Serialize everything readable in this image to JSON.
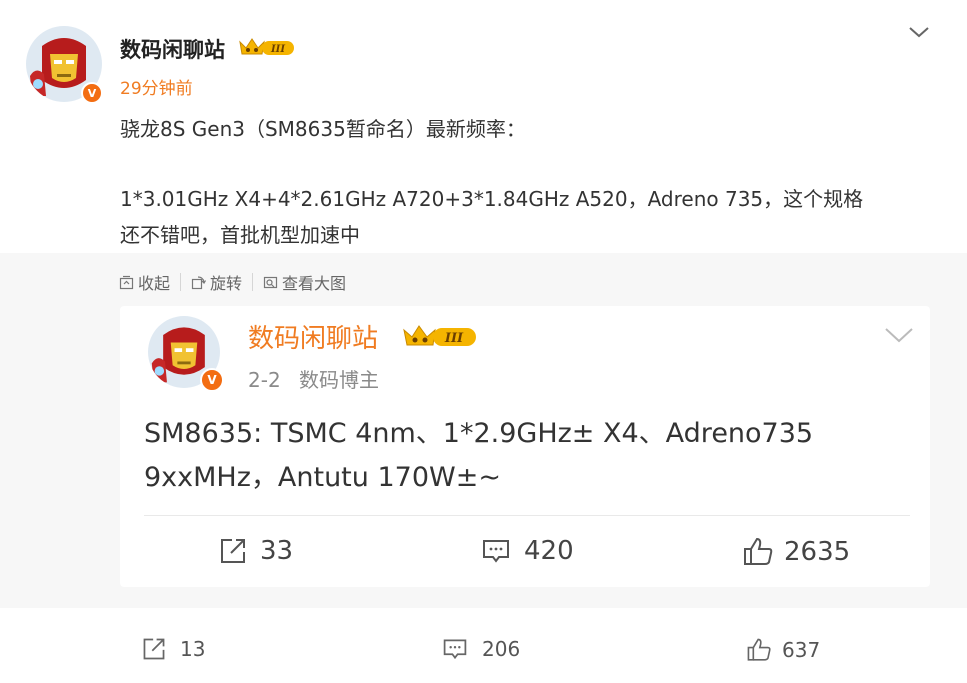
{
  "post": {
    "author": "数码闲聊站",
    "time": "29分钟前",
    "content_lines": [
      "骁龙8S Gen3（SM8635暂命名）最新频率：",
      "1*3.01GHz X4+4*2.61GHz A720+3*1.84GHz A520，Adreno 735，这个规格",
      "还不错吧，首批机型加速中"
    ],
    "level_badge": "III",
    "verified_badge": "V",
    "mini_actions": {
      "collapse": "收起",
      "rotate": "旋转",
      "view_large": "查看大图"
    },
    "stats": {
      "reposts": "13",
      "comments": "206",
      "likes": "637"
    }
  },
  "retweet": {
    "author": "数码闲聊站",
    "date": "2-2",
    "role": "数码博主",
    "content_lines": [
      "SM8635: TSMC 4nm、1*2.9GHz± X4、Adreno735",
      "9xxMHz，Antutu 170W±~"
    ],
    "level_badge": "III",
    "verified_badge": "V",
    "stats": {
      "reposts": "33",
      "comments": "420",
      "likes": "2635"
    }
  },
  "colors": {
    "accent_orange": "#f07c22",
    "retweet_bg": "#f7f7f7",
    "crown_gold": "#f5b400"
  },
  "icons": [
    "chevron-down-icon",
    "collapse-icon",
    "rotate-icon",
    "image-view-icon",
    "share-icon",
    "comment-icon",
    "like-icon",
    "crown-icon",
    "verified-icon"
  ]
}
